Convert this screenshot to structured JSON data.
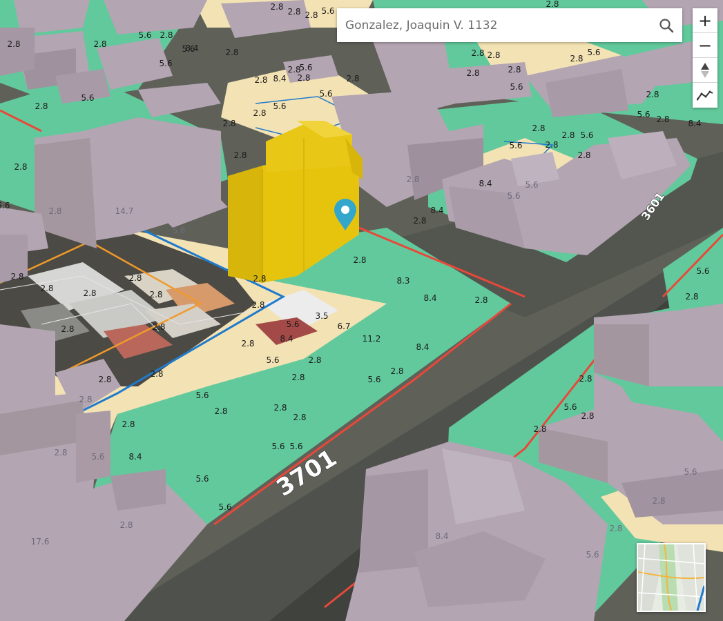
{
  "search": {
    "placeholder": "Gonzalez, Joaquin V. 1132"
  },
  "controls": {
    "zoom_in": "+",
    "zoom_out": "−",
    "compass_icon": "compass-arrow-icon",
    "profile_icon": "elevation-profile-icon",
    "search_icon": "magnifier-icon"
  },
  "street_labels": [
    "3701",
    "3601"
  ],
  "parcel_values": {
    "v28": "2.8",
    "v56": "5.6",
    "v84": "8.4",
    "v83": "8.3",
    "v112": "11.2",
    "v35": "3.5",
    "v67": "6.7",
    "v147": "14.7",
    "v176": "17.6"
  },
  "colors": {
    "building": "#b3a5b2",
    "zone_green": "#62c99c",
    "zone_cream": "#f3e2b4",
    "selected_building": "#e6c40e",
    "marker": "#33a6cc",
    "boundary_blue": "#1f7acc",
    "boundary_orange": "#f09a2a",
    "street_red": "#e8483a"
  }
}
